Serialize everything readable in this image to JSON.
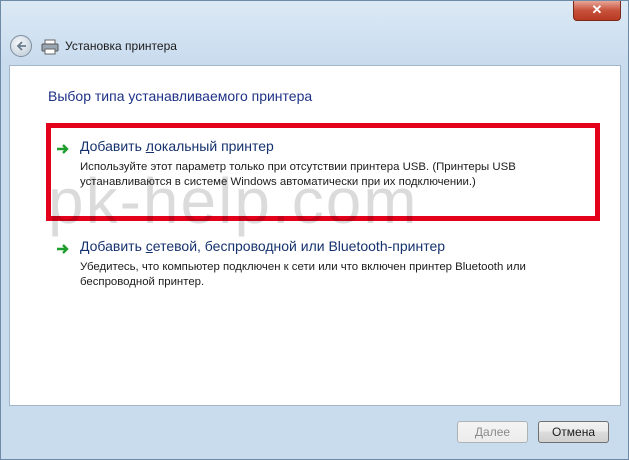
{
  "window": {
    "title": "Установка принтера",
    "close_label": "✕"
  },
  "content": {
    "heading": "Выбор типа устанавливаемого принтера",
    "options": [
      {
        "title_prefix": "Добавить ",
        "title_underlined": "л",
        "title_suffix": "окальный принтер",
        "description": "Используйте этот параметр только при отсутствии принтера USB. (Принтеры USB устанавливаются в системе Windows автоматически при их подключении.)"
      },
      {
        "title_prefix": "Добавить ",
        "title_underlined": "с",
        "title_suffix": "етевой, беспроводной или Bluetooth-принтер",
        "description": "Убедитесь, что компьютер подключен к сети или что включен принтер Bluetooth или беспроводной принтер."
      }
    ],
    "watermark": "pk-help.com"
  },
  "buttons": {
    "next_label": "Далее",
    "cancel_label": "Отмена"
  },
  "colors": {
    "highlight_border": "#e3001b",
    "heading": "#1e3287",
    "arrow": "#1f9e2f"
  }
}
